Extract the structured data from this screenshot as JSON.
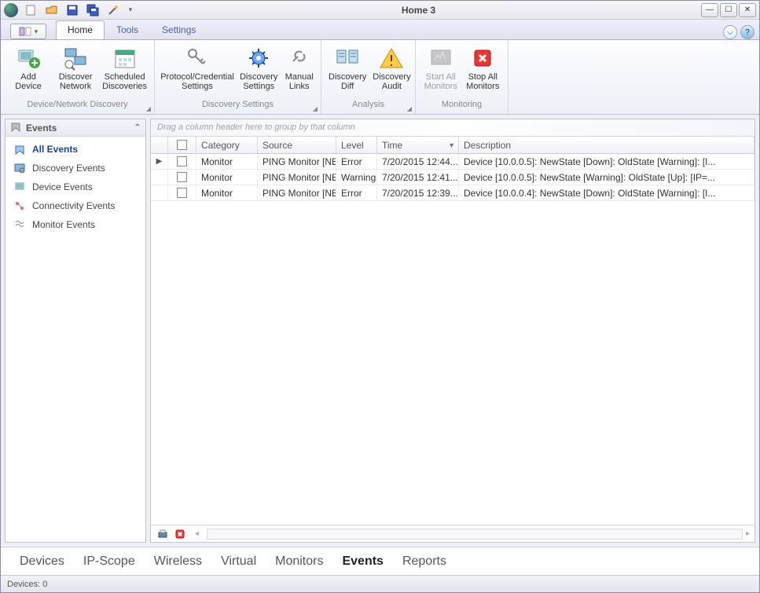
{
  "title": "Home 3",
  "tabs": {
    "home": "Home",
    "tools": "Tools",
    "settings": "Settings"
  },
  "ribbon": {
    "g1_label": "Device/Network Discovery",
    "g2_label": "Discovery Settings",
    "g3_label": "Analysis",
    "g4_label": "Monitoring",
    "add_device": "Add Device",
    "discover_network": "Discover Network",
    "scheduled_discoveries": "Scheduled Discoveries",
    "protocol_settings": "Protocol/Credential Settings",
    "discovery_settings": "Discovery Settings",
    "manual_links": "Manual Links",
    "discovery_diff": "Discovery Diff",
    "discovery_audit": "Discovery Audit",
    "start_all": "Start All Monitors",
    "stop_all": "Stop All Monitors"
  },
  "side": {
    "header": "Events",
    "items": [
      "All Events",
      "Discovery Events",
      "Device Events",
      "Connectivity Events",
      "Monitor Events"
    ]
  },
  "grid": {
    "group_hint": "Drag a column header here to group by that column",
    "cols": {
      "category": "Category",
      "source": "Source",
      "level": "Level",
      "time": "Time",
      "description": "Description"
    },
    "rows": [
      {
        "category": "Monitor",
        "source": "PING Monitor [NE...",
        "level": "Error",
        "time": "7/20/2015 12:44...",
        "description": "Device [10.0.0.5]: NewState [Down]: OldState [Warning]: [I..."
      },
      {
        "category": "Monitor",
        "source": "PING Monitor [NE...",
        "level": "Warning",
        "time": "7/20/2015 12:41...",
        "description": "Device [10.0.0.5]: NewState [Warning]: OldState [Up]: [IP=..."
      },
      {
        "category": "Monitor",
        "source": "PING Monitor [NE...",
        "level": "Error",
        "time": "7/20/2015 12:39...",
        "description": "Device [10.0.0.4]: NewState [Down]: OldState [Warning]: [I..."
      }
    ]
  },
  "bottom_tabs": [
    "Devices",
    "IP-Scope",
    "Wireless",
    "Virtual",
    "Monitors",
    "Events",
    "Reports"
  ],
  "bottom_active": "Events",
  "status": "Devices: 0"
}
